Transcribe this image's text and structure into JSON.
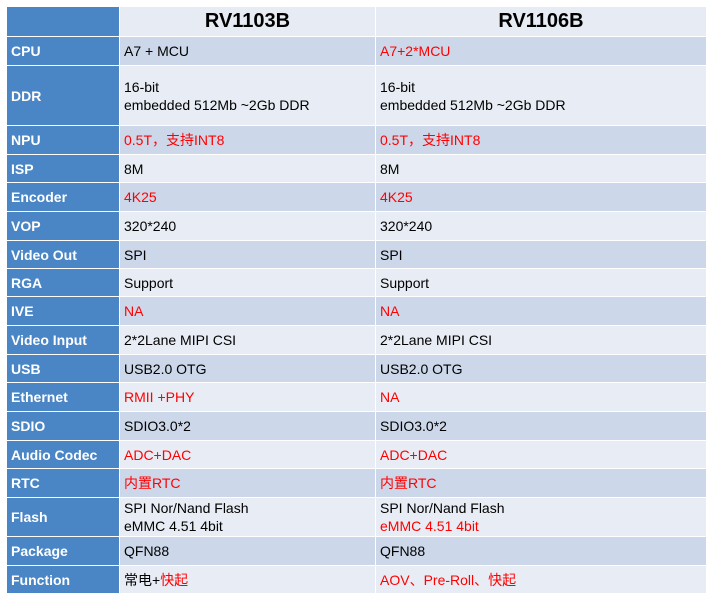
{
  "header": {
    "corner": "",
    "col_a": "RV1103B",
    "col_b": "RV1106B"
  },
  "colors": {
    "label_bg": "#4a86c6",
    "row_odd": "#ccd8ea",
    "row_even": "#e8edf5",
    "highlight_red": "#ff0000"
  },
  "rows": [
    {
      "label": "CPU",
      "a": [
        {
          "t": "A7 + MCU",
          "red": false
        }
      ],
      "b": [
        {
          "t": "A7+2*MCU",
          "red": true
        }
      ]
    },
    {
      "label": "DDR",
      "a": [
        {
          "t": "16-bit",
          "red": false
        },
        {
          "t": "embedded 512Mb  ~2Gb DDR",
          "red": false
        }
      ],
      "b": [
        {
          "t": "16-bit",
          "red": false
        },
        {
          "t": "embedded 512Mb  ~2Gb DDR",
          "red": false
        }
      ]
    },
    {
      "label": "NPU",
      "a": [
        {
          "t": "0.5T，支持INT8",
          "red": true
        }
      ],
      "b": [
        {
          "t": "0.5T，支持INT8",
          "red": true
        }
      ]
    },
    {
      "label": "ISP",
      "a": [
        {
          "t": "8M",
          "red": false
        }
      ],
      "b": [
        {
          "t": "8M",
          "red": false
        }
      ]
    },
    {
      "label": "Encoder",
      "a": [
        {
          "t": "4K25",
          "red": true
        }
      ],
      "b": [
        {
          "t": "4K25",
          "red": true
        }
      ]
    },
    {
      "label": "VOP",
      "a": [
        {
          "t": "320*240",
          "red": false
        }
      ],
      "b": [
        {
          "t": "320*240",
          "red": false
        }
      ]
    },
    {
      "label": "Video Out",
      "a": [
        {
          "t": "SPI",
          "red": false
        }
      ],
      "b": [
        {
          "t": "SPI",
          "red": false
        }
      ]
    },
    {
      "label": "RGA",
      "a": [
        {
          "t": "Support",
          "red": false
        }
      ],
      "b": [
        {
          "t": "Support",
          "red": false
        }
      ]
    },
    {
      "label": "IVE",
      "a": [
        {
          "t": "NA",
          "red": true
        }
      ],
      "b": [
        {
          "t": "NA",
          "red": true
        }
      ]
    },
    {
      "label": "Video Input",
      "a": [
        {
          "t": "2*2Lane MIPI CSI",
          "red": false
        }
      ],
      "b": [
        {
          "t": "2*2Lane MIPI CSI",
          "red": false
        }
      ]
    },
    {
      "label": "USB",
      "a": [
        {
          "t": "USB2.0 OTG",
          "red": false
        }
      ],
      "b": [
        {
          "t": "USB2.0 OTG",
          "red": false
        }
      ]
    },
    {
      "label": "Ethernet",
      "a": [
        {
          "t": "RMII +PHY",
          "red": true
        }
      ],
      "b": [
        {
          "t": "NA",
          "red": true
        }
      ]
    },
    {
      "label": "SDIO",
      "a": [
        {
          "t": "SDIO3.0*2",
          "red": false
        }
      ],
      "b": [
        {
          "t": "SDIO3.0*2",
          "red": false
        }
      ]
    },
    {
      "label": "Audio Codec",
      "a": [
        {
          "t": "ADC+DAC",
          "red": true
        }
      ],
      "b": [
        {
          "t": "ADC+DAC",
          "red": true
        }
      ]
    },
    {
      "label": "RTC",
      "a": [
        {
          "t": "内置RTC",
          "red": true
        }
      ],
      "b": [
        {
          "t": "内置RTC",
          "red": true
        }
      ]
    },
    {
      "label": "Flash",
      "a": [
        {
          "t": "SPI Nor/Nand Flash",
          "red": false
        },
        {
          "t": "eMMC 4.51 4bit",
          "red": false
        }
      ],
      "b": [
        {
          "t": "SPI Nor/Nand Flash",
          "red": false
        },
        {
          "t": "eMMC 4.51 4bit",
          "red": true
        }
      ]
    },
    {
      "label": "Package",
      "a": [
        {
          "t": "QFN88",
          "red": false
        }
      ],
      "b": [
        {
          "t": "QFN88",
          "red": false
        }
      ]
    },
    {
      "label": "Function",
      "a": [
        {
          "t": "常电+",
          "red": false,
          "inline": true
        },
        {
          "t": "快起",
          "red": true,
          "inline": true
        }
      ],
      "b": [
        {
          "t": "AOV、Pre-Roll、快起",
          "red": true
        }
      ]
    }
  ]
}
